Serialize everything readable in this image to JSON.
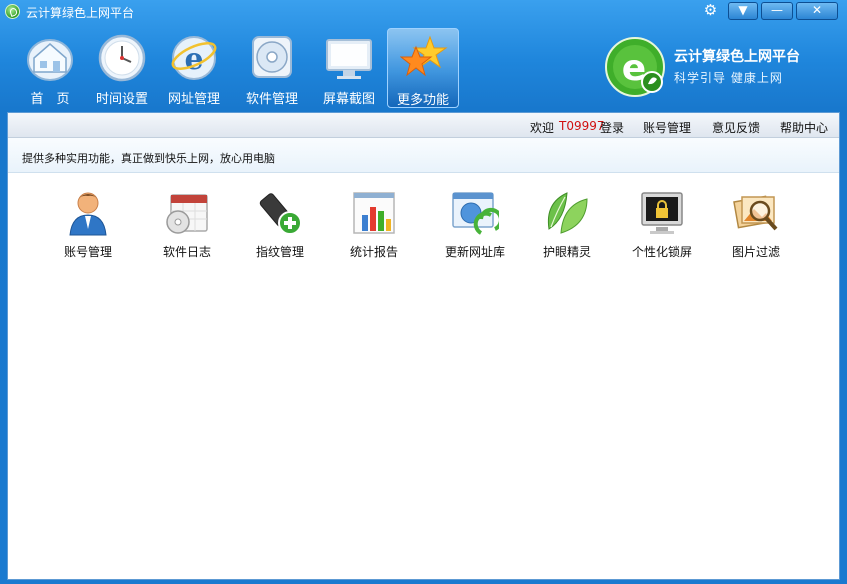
{
  "window": {
    "title": "云计算绿色上网平台",
    "controls": {
      "menu": "▼",
      "minimize": "—",
      "close": "✕"
    }
  },
  "toolbar": {
    "items": [
      {
        "label": "首　页",
        "icon": "home-icon"
      },
      {
        "label": "时间设置",
        "icon": "clock-icon"
      },
      {
        "label": "网址管理",
        "icon": "ie-browser-icon"
      },
      {
        "label": "软件管理",
        "icon": "disc-icon"
      },
      {
        "label": "屏幕截图",
        "icon": "monitor-icon"
      },
      {
        "label": "更多功能",
        "icon": "stars-icon",
        "active": true
      }
    ]
  },
  "brand": {
    "title": "云计算绿色上网平台",
    "subtitle": "科学引导  健康上网"
  },
  "statusbar": {
    "welcome": "欢迎",
    "user_id": "T09997",
    "login": "登录",
    "links": [
      "账号管理",
      "意见反馈",
      "帮助中心"
    ]
  },
  "tagline": "提供多种实用功能，真正做到快乐上网，放心用电脑",
  "functions": [
    {
      "label": "账号管理",
      "icon": "user-icon"
    },
    {
      "label": "软件日志",
      "icon": "calendar-disc-icon"
    },
    {
      "label": "指纹管理",
      "icon": "usb-add-icon"
    },
    {
      "label": "统计报告",
      "icon": "chart-report-icon"
    },
    {
      "label": "更新网址库",
      "icon": "web-refresh-icon"
    },
    {
      "label": "护眼精灵",
      "icon": "leaf-icon"
    },
    {
      "label": "个性化锁屏",
      "icon": "lock-screen-icon"
    },
    {
      "label": "图片过滤",
      "icon": "image-search-icon"
    }
  ],
  "colors": {
    "titlebar": "#2a8ee2",
    "accent_red": "#d01010",
    "panel_border": "#5d9ad4"
  }
}
